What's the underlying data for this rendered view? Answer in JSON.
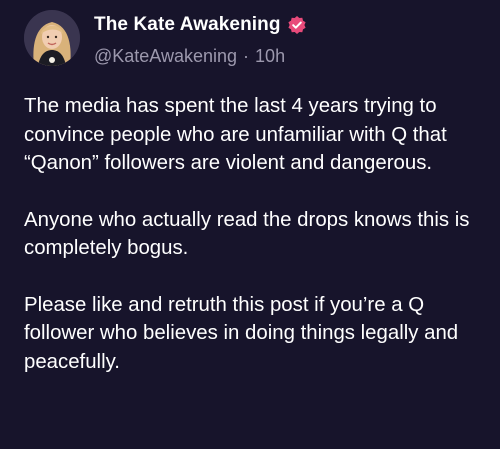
{
  "post": {
    "author": {
      "display_name": "The Kate Awakening",
      "handle": "@KateAwakening",
      "verified": true,
      "avatar_icon": "profile-photo"
    },
    "separator": "·",
    "time_ago": "10h",
    "paragraphs": [
      "The media has spent the last 4 years trying to convince people who are unfamiliar with Q that “Qanon” followers are violent and dangerous.",
      "Anyone who actually read the drops knows this is completely bogus.",
      "Please like and retruth this post if you’re a Q follower who believes in doing things legally and peacefully."
    ]
  },
  "colors": {
    "background": "#17142b",
    "text": "#ffffff",
    "muted": "#9c98ad",
    "verified_badge": "#e84a7a"
  }
}
